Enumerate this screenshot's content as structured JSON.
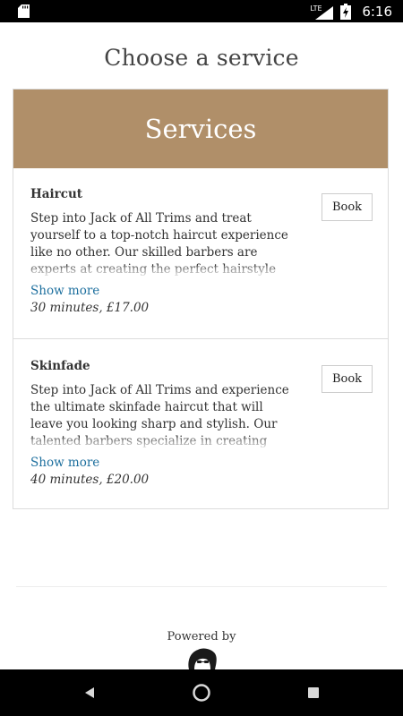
{
  "status_bar": {
    "network_label": "LTE",
    "time": "6:16",
    "icons": [
      "sd-card-icon",
      "lte-signal-icon",
      "battery-charging-icon"
    ]
  },
  "page": {
    "title": "Choose a service"
  },
  "services": {
    "header": "Services",
    "items": [
      {
        "name": "Haircut",
        "description": "Step into Jack of All Trims and treat yourself to a top-notch haircut experience like no other. Our skilled barbers are experts at creating the perfect hairstyle to suit your individual style and preferences.",
        "show_more": "Show more",
        "meta": "30 minutes, £17.00",
        "book_label": "Book"
      },
      {
        "name": "Skinfade",
        "description": "Step into Jack of All Trims and experience the ultimate skinfade haircut that will leave you looking sharp and stylish. Our talented barbers specialize in creating the perfect fade, seamlessly blending different lengths.",
        "show_more": "Show more",
        "meta": "40 minutes, £20.00",
        "book_label": "Book"
      }
    ]
  },
  "footer": {
    "powered_by": "Powered by",
    "logo_icon": "barber-logo-icon"
  },
  "nav_bar": {
    "icons": [
      "back-icon",
      "home-icon",
      "recent-apps-icon"
    ]
  },
  "colors": {
    "header_bg": "#b08f69",
    "link": "#1d6f9e",
    "text": "#333333"
  }
}
